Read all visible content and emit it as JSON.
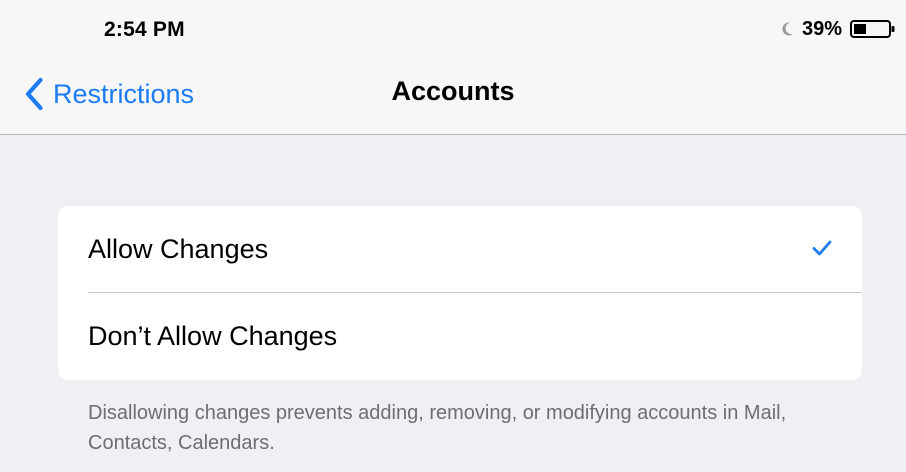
{
  "status_bar": {
    "time": "2:54 PM",
    "moon_icon": "moon-icon",
    "battery_percent": "39%",
    "battery_icon": "battery-icon"
  },
  "nav": {
    "back_label": "Restrictions",
    "back_icon": "chevron-left-icon",
    "title": "Accounts"
  },
  "options": {
    "allow_label": "Allow Changes",
    "dont_allow_label": "Don’t Allow Changes",
    "selected": "Allow Changes",
    "checkmark_icon": "checkmark-icon"
  },
  "footer": {
    "note": "Disallowing changes prevents adding, removing, or modifying accounts in Mail, Contacts, Calendars."
  },
  "colors": {
    "accent": "#1b7cf5",
    "background": "#efeff4",
    "bar": "#f7f7f7",
    "footer_text": "#6d6d72"
  }
}
